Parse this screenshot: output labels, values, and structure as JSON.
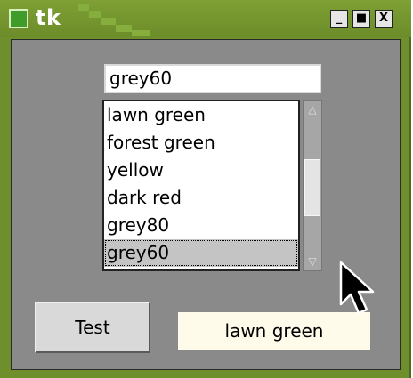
{
  "window": {
    "title": "tk",
    "controls": {
      "minimize": "_",
      "maximize": "■",
      "close": "X"
    },
    "frame_color": "#6f8f2c"
  },
  "entry": {
    "value": "grey60"
  },
  "listbox": {
    "items": [
      {
        "label": "lawn green"
      },
      {
        "label": "forest green"
      },
      {
        "label": "yellow"
      },
      {
        "label": "dark red"
      },
      {
        "label": "grey80"
      },
      {
        "label": "grey60"
      }
    ],
    "selected_index": 5
  },
  "scrollbar": {
    "up_arrow": "△",
    "down_arrow": "▽"
  },
  "test_button": {
    "label": "Test"
  },
  "output_label": {
    "text": "lawn green",
    "background": "#fffbea"
  }
}
